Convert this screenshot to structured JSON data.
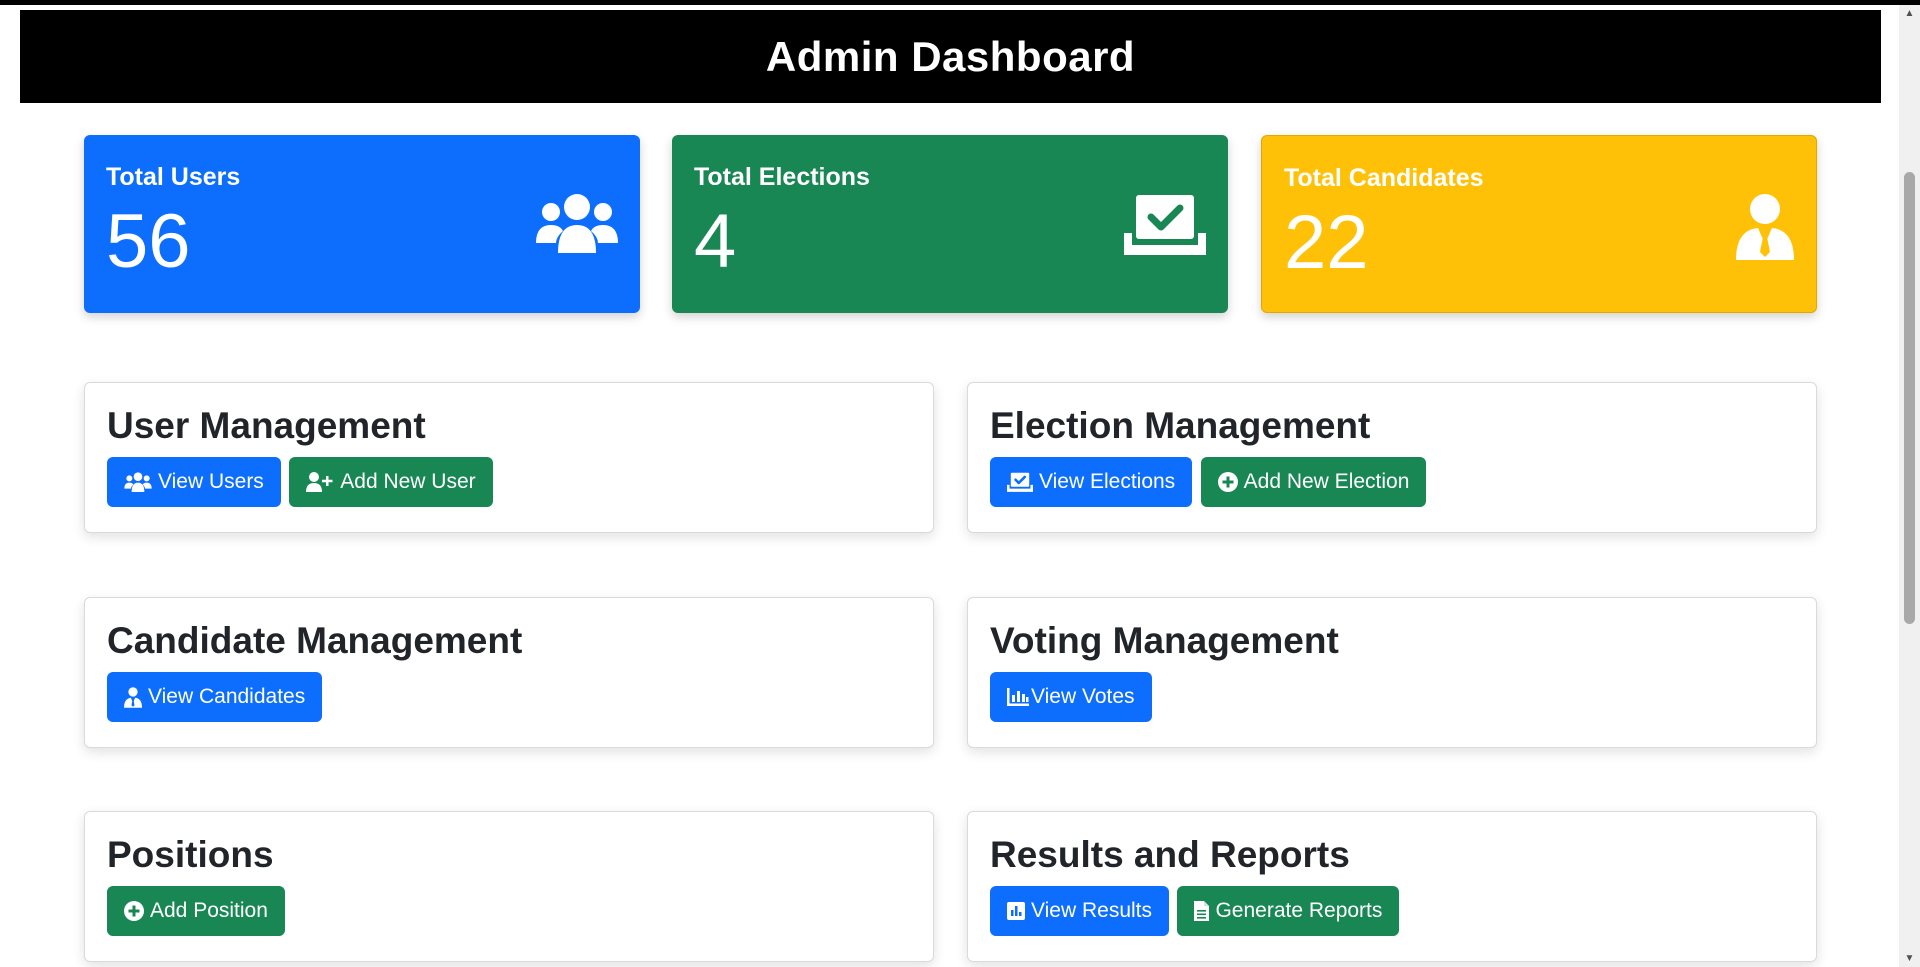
{
  "header": {
    "title": "Admin Dashboard"
  },
  "stats": [
    {
      "title": "Total Users",
      "value": "56",
      "icon": "users-icon",
      "color": "#0d6efd"
    },
    {
      "title": "Total Elections",
      "value": "4",
      "icon": "ballot-box-check-icon",
      "color": "#198754"
    },
    {
      "title": "Total Candidates",
      "value": "22",
      "icon": "user-tie-icon",
      "color": "#ffc107"
    }
  ],
  "sections": {
    "user_management": {
      "title": "User Management",
      "buttons": [
        {
          "label": "View Users",
          "icon": "users-icon",
          "color": "#0d6efd"
        },
        {
          "label": "Add New User",
          "icon": "user-plus-icon",
          "color": "#198754"
        }
      ]
    },
    "election_management": {
      "title": "Election Management",
      "buttons": [
        {
          "label": "View Elections",
          "icon": "ballot-box-check-icon",
          "color": "#0d6efd"
        },
        {
          "label": "Add New Election",
          "icon": "plus-circle-icon",
          "color": "#198754"
        }
      ]
    },
    "candidate_management": {
      "title": "Candidate Management",
      "buttons": [
        {
          "label": "View Candidates",
          "icon": "user-tie-icon",
          "color": "#0d6efd"
        }
      ]
    },
    "voting_management": {
      "title": "Voting Management",
      "buttons": [
        {
          "label": "View Votes",
          "icon": "bar-chart-icon",
          "color": "#0d6efd"
        }
      ]
    },
    "positions": {
      "title": "Positions",
      "buttons": [
        {
          "label": "Add Position",
          "icon": "plus-circle-icon",
          "color": "#198754"
        }
      ]
    },
    "results_reports": {
      "title": "Results and Reports",
      "buttons": [
        {
          "label": "View Results",
          "icon": "chart-square-icon",
          "color": "#0d6efd"
        },
        {
          "label": "Generate Reports",
          "icon": "file-icon",
          "color": "#198754"
        }
      ]
    }
  }
}
